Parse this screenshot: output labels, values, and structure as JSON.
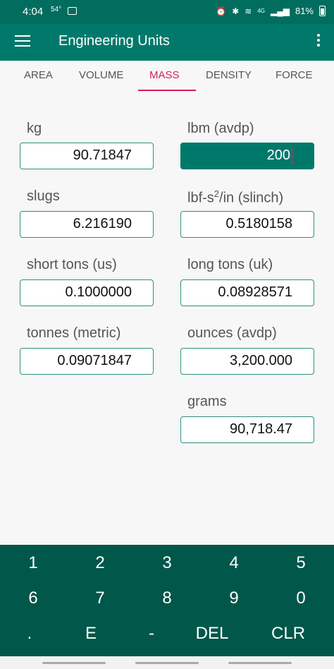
{
  "status_bar": {
    "time": "4:04",
    "temp": "54°",
    "network": "4G",
    "battery": "81%"
  },
  "app_bar": {
    "title": "Engineering Units"
  },
  "tabs": [
    "AREA",
    "VOLUME",
    "MASS",
    "DENSITY",
    "FORCE"
  ],
  "active_tab": "MASS",
  "fields": {
    "kg": {
      "label": "kg",
      "value": "90.71847"
    },
    "lbm": {
      "label": "lbm (avdp)",
      "value": "200"
    },
    "slugs": {
      "label": "slugs",
      "value": "6.216190"
    },
    "slinch": {
      "label_pre": "lbf-s",
      "label_sup": "2",
      "label_post": "/in (slinch)",
      "value": "0.5180158"
    },
    "short_tons": {
      "label": "short tons (us)",
      "value": "0.1000000"
    },
    "long_tons": {
      "label": "long tons (uk)",
      "value": "0.08928571"
    },
    "tonnes": {
      "label": "tonnes (metric)",
      "value": "0.09071847"
    },
    "ounces": {
      "label": "ounces (avdp)",
      "value": "3,200.000"
    },
    "grams": {
      "label": "grams",
      "value": "90,718.47"
    }
  },
  "keypad": {
    "row1": [
      "1",
      "2",
      "3",
      "4",
      "5"
    ],
    "row2": [
      "6",
      "7",
      "8",
      "9",
      "0"
    ],
    "row3": [
      ".",
      "E",
      "-",
      "DEL",
      "CLR"
    ]
  },
  "colors": {
    "primary": "#00796b",
    "status": "#006d5f",
    "keypad": "#00574a",
    "accent": "#d81b60"
  }
}
